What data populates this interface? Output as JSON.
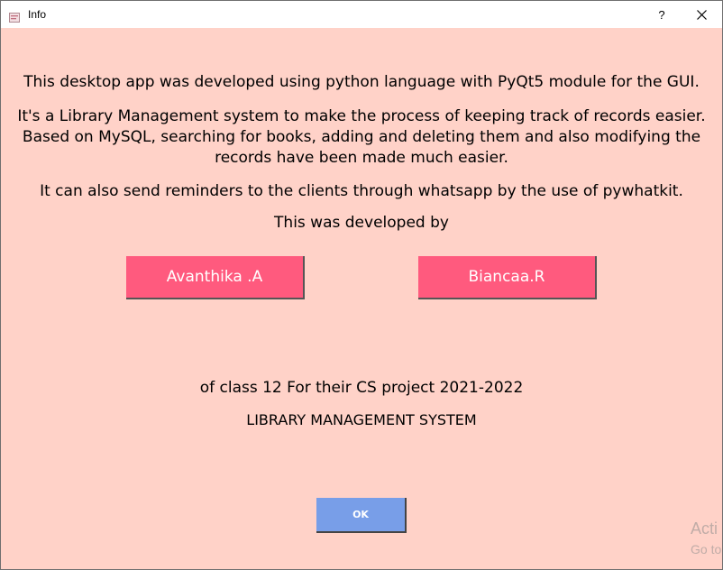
{
  "window": {
    "title": "Info",
    "help_label": "?",
    "background": "#ffd2c8"
  },
  "content": {
    "line1": "This desktop app was developed using python language with PyQt5 module for the GUI.",
    "line2": "It's a Library Management system to make the process of keeping track of records easier. Based on MySQL, searching for books, adding and deleting them and also modifying the records have been made much easier.",
    "line3": "It can also send reminders to the clients through whatsapp by the use of pywhatkit.",
    "line4": "This was developed by",
    "developer1": "Avanthika .A",
    "developer2": "Biancaa.R",
    "line5": "of class 12 For their CS project 2021-2022",
    "line6": "LIBRARY MANAGEMENT SYSTEM"
  },
  "buttons": {
    "ok_label": "OK",
    "name_button_color": "#ff5a7e",
    "ok_button_color": "#789ee8"
  },
  "watermark": {
    "line1": "Acti",
    "line2": "Go to"
  }
}
